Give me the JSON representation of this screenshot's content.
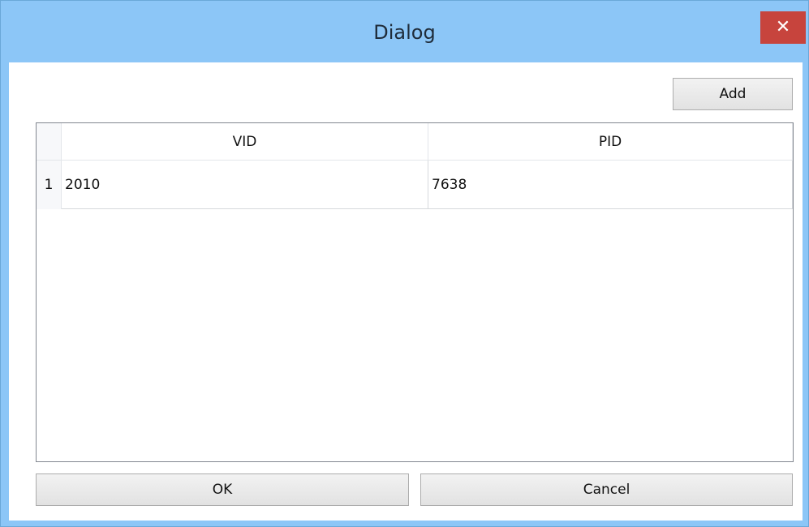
{
  "window": {
    "title": "Dialog",
    "close_glyph": "✕"
  },
  "toolbar": {
    "add_label": "Add"
  },
  "table": {
    "columns": [
      "VID",
      "PID"
    ],
    "rows": [
      {
        "index": "1",
        "vid": "2010",
        "pid": "7638"
      }
    ]
  },
  "footer": {
    "ok_label": "OK",
    "cancel_label": "Cancel"
  },
  "colors": {
    "titlebar": "#8cc6f7",
    "close_button": "#c7443d",
    "button_face": "#e9e9e9",
    "table_border": "#828790"
  }
}
